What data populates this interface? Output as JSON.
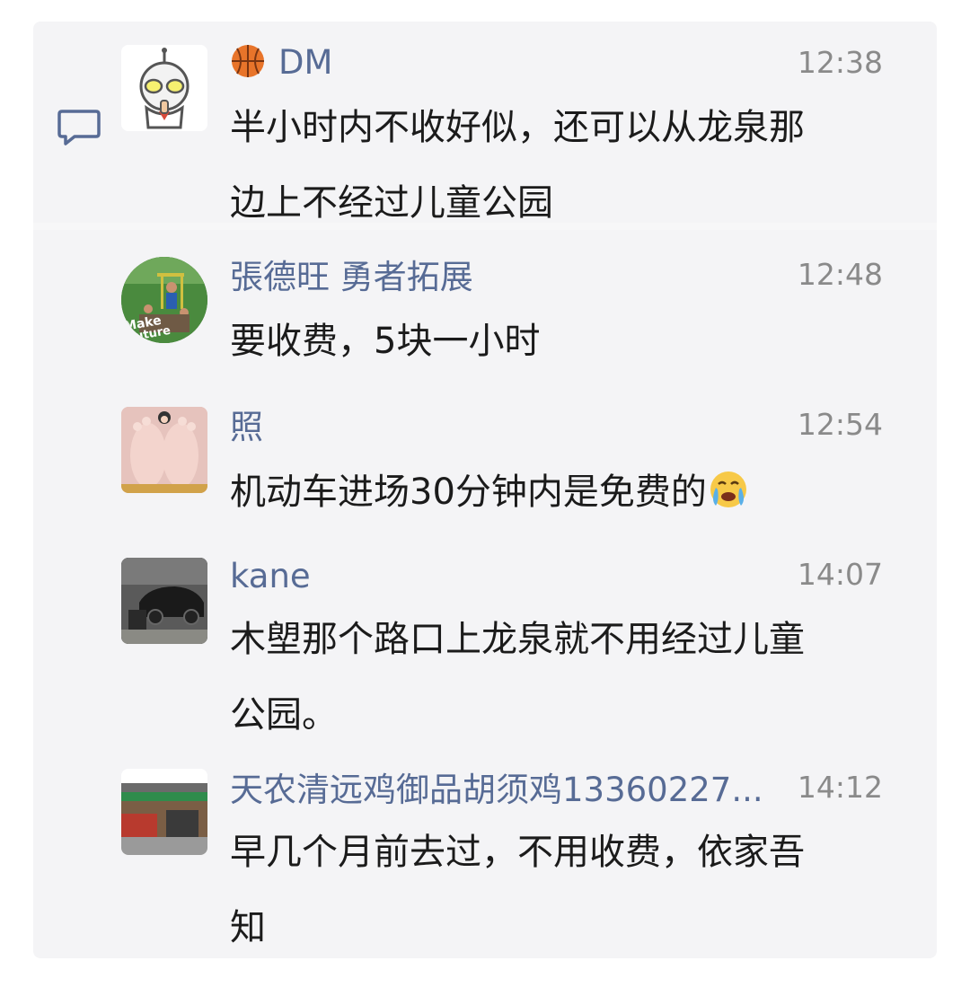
{
  "messages": [
    {
      "name": "DM",
      "name_emoji": "basketball-icon",
      "time": "12:38",
      "text_lines": [
        "半小时内不收好似，还可以从龙泉那",
        "边上不经过儿童公园"
      ],
      "avatar": "ultraman-avatar"
    },
    {
      "name": "張德旺 勇者拓展",
      "time": "12:48",
      "text_lines": [
        "要收费，5块一小时"
      ],
      "avatar": "outdoor-group-avatar"
    },
    {
      "name": "照",
      "time": "12:54",
      "text_lines": [
        "机动车进场30分钟内是免费的"
      ],
      "text_emoji": "crying-face-icon",
      "avatar": "baby-feet-avatar"
    },
    {
      "name": "kane",
      "time": "14:07",
      "text_lines": [
        "木塱那个路口上龙泉就不用经过儿童",
        "公园。"
      ],
      "avatar": "car-avatar"
    },
    {
      "name": "天农清远鸡御品胡须鸡13360227...",
      "time": "14:12",
      "text_lines": [
        "早几个月前去过，不用收费，依家吾",
        "知"
      ],
      "avatar": "shop-avatar"
    }
  ],
  "colors": {
    "name": "#576b95",
    "time": "#8a8a8a",
    "text": "#1b1b1b",
    "panel": "#f4f4f6"
  }
}
